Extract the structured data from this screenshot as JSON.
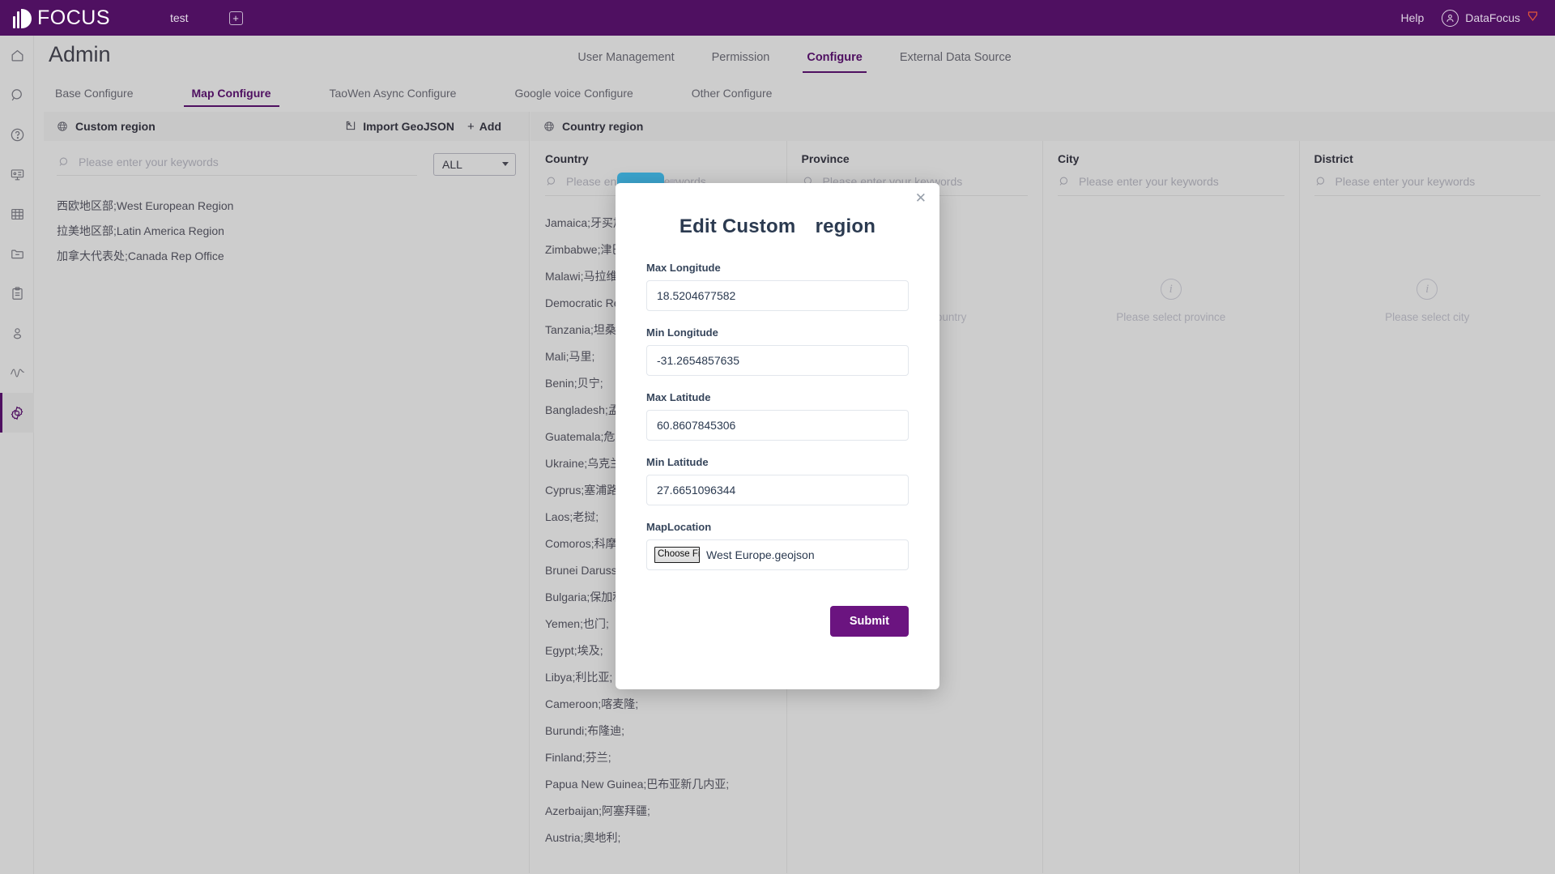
{
  "topbar": {
    "brand": "FOCUS",
    "workspace_tab": "test",
    "add_tab_icon": "plus-icon",
    "help": "Help",
    "user": "DataFocus",
    "user_icon": "user-avatar-icon",
    "badge_icon": "shield-icon"
  },
  "rail": {
    "items": [
      {
        "name": "home-icon"
      },
      {
        "name": "search-icon"
      },
      {
        "name": "help-circle-icon"
      },
      {
        "name": "dashboard-icon"
      },
      {
        "name": "table-icon"
      },
      {
        "name": "folder-icon"
      },
      {
        "name": "clipboard-icon"
      },
      {
        "name": "user-icon"
      },
      {
        "name": "activity-icon"
      },
      {
        "name": "gear-icon"
      }
    ],
    "active_index": 9
  },
  "page": {
    "title": "Admin"
  },
  "topnav": {
    "items": [
      {
        "label": "User Management",
        "active": false
      },
      {
        "label": "Permission",
        "active": false
      },
      {
        "label": "Configure",
        "active": true
      },
      {
        "label": "External Data Source",
        "active": false
      }
    ]
  },
  "subnav": {
    "items": [
      {
        "label": "Base Configure",
        "active": false
      },
      {
        "label": "Map Configure",
        "active": true
      },
      {
        "label": "TaoWen Async Configure",
        "active": false
      },
      {
        "label": "Google voice Configure",
        "active": false
      },
      {
        "label": "Other Configure",
        "active": false
      }
    ]
  },
  "custom_region": {
    "header": "Custom region",
    "header_icon": "globe-icon",
    "import_geojson": "Import GeoJSON",
    "import_icon": "import-icon",
    "add": "Add",
    "add_icon": "plus-icon",
    "search_placeholder": "Please enter your keywords",
    "search_value": "",
    "filter_selected": "ALL",
    "items": [
      "西欧地区部;West European Region",
      "拉美地区部;Latin America Region",
      "加拿大代表处;Canada Rep Office"
    ]
  },
  "country_region": {
    "header": "Country region",
    "header_icon": "globe-icon",
    "columns": [
      {
        "title": "Country",
        "search_placeholder": "Please enter your keywords",
        "search_value": "",
        "items": [
          "Jamaica;牙买加;",
          "Zimbabwe;津巴布韦;",
          "Malawi;马拉维;",
          "Democratic Republic of Congo;刚果（金）；",
          "Tanzania;坦桑尼亚;",
          "Mali;马里;",
          "Benin;贝宁;",
          "Bangladesh;孟加拉;",
          "Guatemala;危地马拉;",
          "Ukraine;乌克兰;",
          "Cyprus;塞浦路斯;",
          "Laos;老挝;",
          "Comoros;科摩罗;",
          "Brunei Darussalam;文莱;",
          "Bulgaria;保加利亚;",
          "Yemen;也门;",
          "Egypt;埃及;",
          "Libya;利比亚;",
          "Cameroon;喀麦隆;",
          "Burundi;布隆迪;",
          "Finland;芬兰;",
          "Papua New Guinea;巴布亚新几内亚;",
          "Azerbaijan;阿塞拜疆;",
          "Austria;奥地利;"
        ],
        "empty": null
      },
      {
        "title": "Province",
        "search_placeholder": "Please enter your keywords",
        "search_value": "",
        "items": [],
        "empty": {
          "icon": "info-icon",
          "text": "Please select country"
        }
      },
      {
        "title": "City",
        "search_placeholder": "Please enter your keywords",
        "search_value": "",
        "items": [],
        "empty": {
          "icon": "info-icon",
          "text": "Please select province"
        }
      },
      {
        "title": "District",
        "search_placeholder": "Please enter your keywords",
        "search_value": "",
        "items": [],
        "empty": {
          "icon": "info-icon",
          "text": "Please select city"
        }
      }
    ]
  },
  "modal": {
    "title": "Edit Custom　region",
    "close_icon": "close-icon",
    "fields": [
      {
        "label": "Max Longitude",
        "value": "18.5204677582"
      },
      {
        "label": "Min Longitude",
        "value": "-31.2654857635"
      },
      {
        "label": "Max Latitude",
        "value": "60.8607845306"
      },
      {
        "label": "Min Latitude",
        "value": "27.6651096344"
      }
    ],
    "file_field": {
      "label": "MapLocation",
      "button_label": "Choose File",
      "file_name": "West Europe.geojson"
    },
    "submit_label": "Submit"
  },
  "colors": {
    "brand_purple": "#4f1061",
    "accent_purple": "#6b1480",
    "page_bg": "#cdcdcd",
    "modal_bg": "#ffffff",
    "tab_teal": "#3ba3cc"
  }
}
